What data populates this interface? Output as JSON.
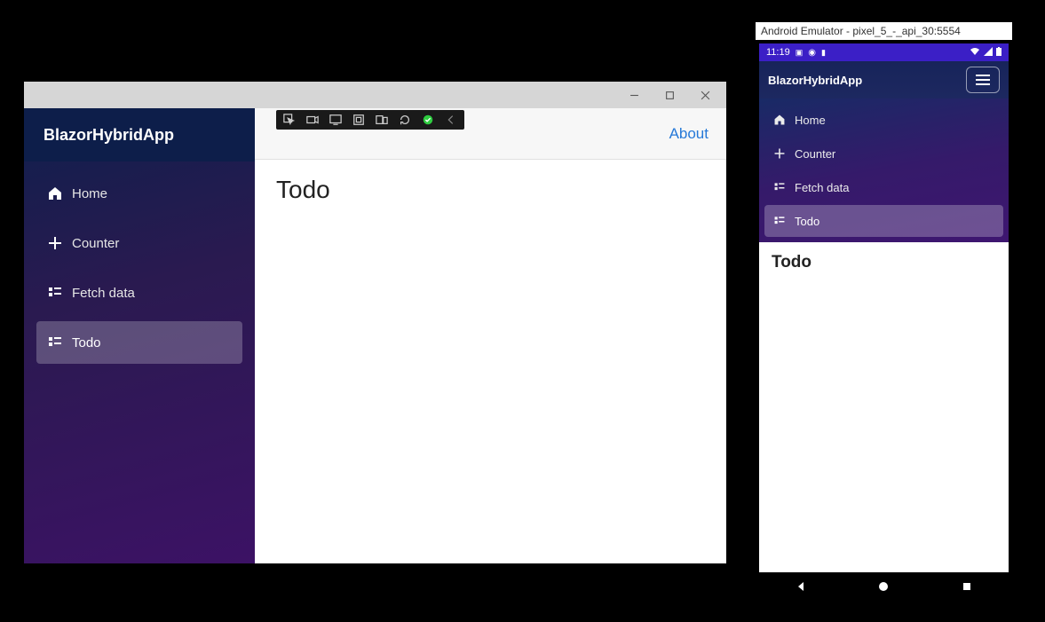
{
  "desktop": {
    "app_title": "BlazorHybridApp",
    "about_label": "About",
    "page_title": "Todo",
    "nav": [
      {
        "label": "Home",
        "icon": "home-icon",
        "active": false
      },
      {
        "label": "Counter",
        "icon": "plus-icon",
        "active": false
      },
      {
        "label": "Fetch data",
        "icon": "list-icon",
        "active": false
      },
      {
        "label": "Todo",
        "icon": "list-icon",
        "active": true
      }
    ]
  },
  "android": {
    "window_title": "Android Emulator - pixel_5_-_api_30:5554",
    "status_time": "11:19",
    "app_title": "BlazorHybridApp",
    "page_title": "Todo",
    "nav": [
      {
        "label": "Home",
        "icon": "home-icon",
        "active": false
      },
      {
        "label": "Counter",
        "icon": "plus-icon",
        "active": false
      },
      {
        "label": "Fetch data",
        "icon": "list-icon",
        "active": false
      },
      {
        "label": "Todo",
        "icon": "list-icon",
        "active": true
      }
    ]
  }
}
